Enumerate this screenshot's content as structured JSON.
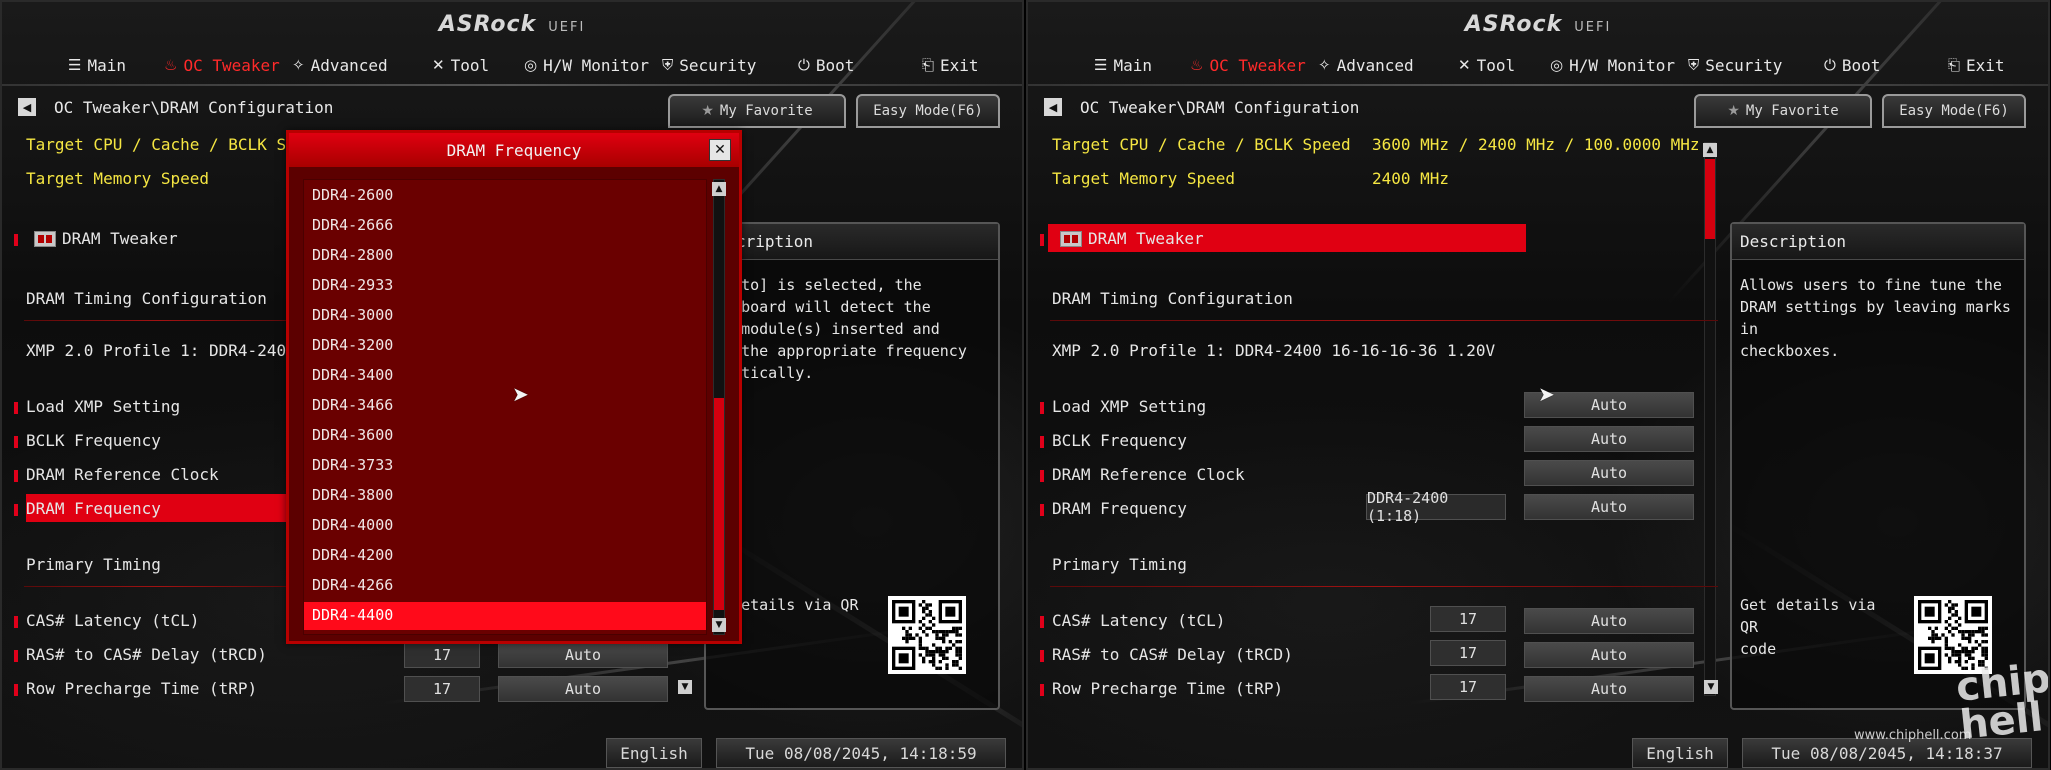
{
  "brand": "ASRock",
  "uefi_label": "UEFI",
  "nav": [
    "Main",
    "OC Tweaker",
    "Advanced",
    "Tool",
    "H/W Monitor",
    "Security",
    "Boot",
    "Exit"
  ],
  "breadcrumb": "OC Tweaker\\DRAM Configuration",
  "my_favorite": "My Favorite",
  "easy_mode": "Easy Mode(F6)",
  "target_cpu_label": "Target CPU / Cache / BCLK Speed",
  "target_cpu_value": "3600 MHz / 2400 MHz / 100.0000 MHz",
  "target_mem_label": "Target Memory Speed",
  "target_mem_value": "2400 MHz",
  "dram_tweaker": "DRAM Tweaker",
  "dram_timing_config": "DRAM Timing Configuration",
  "xmp_profile_full": "XMP 2.0 Profile 1: DDR4-2400 16-16-16-36 1.20V",
  "xmp_profile_cut": "XMP 2.0 Profile 1: DDR4-2400 16-1",
  "settings": {
    "load_xmp": "Load XMP Setting",
    "bclk": "BCLK Frequency",
    "dram_ref": "DRAM Reference Clock",
    "dram_freq": "DRAM Frequency",
    "dram_freq_current": "DDR4-2400 (1:18)",
    "primary_timing": "Primary Timing",
    "cas": "CAS# Latency (tCL)",
    "ras_cas": "RAS# to CAS# Delay (tRCD)",
    "row_pre": "Row Precharge Time (tRP)",
    "auto": "Auto",
    "timing_value": "17"
  },
  "desc_title": "Description",
  "desc_title_cut": "cription",
  "desc_right": "Allows users to fine tune the\nDRAM settings by leaving marks in\ncheckboxes.",
  "desc_left": "[Auto] is selected, the\nherboard will detect the\nry module(s) inserted and\ngn the appropriate frequency\nomatically.",
  "qr_label": "Get details via QR\ncode",
  "qr_label_cut": "t details via QR",
  "language": "English",
  "time_left": "Tue 08/08/2045, 14:18:59",
  "time_right": "Tue 08/08/2045, 14:18:37",
  "popup": {
    "title": "DRAM Frequency",
    "items": [
      "DDR4-2600",
      "DDR4-2666",
      "DDR4-2800",
      "DDR4-2933",
      "DDR4-3000",
      "DDR4-3200",
      "DDR4-3400",
      "DDR4-3466",
      "DDR4-3600",
      "DDR4-3733",
      "DDR4-3800",
      "DDR4-4000",
      "DDR4-4200",
      "DDR4-4266",
      "DDR4-4400"
    ],
    "selected_index": 14
  },
  "ghost_left": "3600 MHz",
  "ghost_right": "0.0000 MHz",
  "watermark_url": "www.chiphell.com",
  "watermark_logo": "chip hell"
}
